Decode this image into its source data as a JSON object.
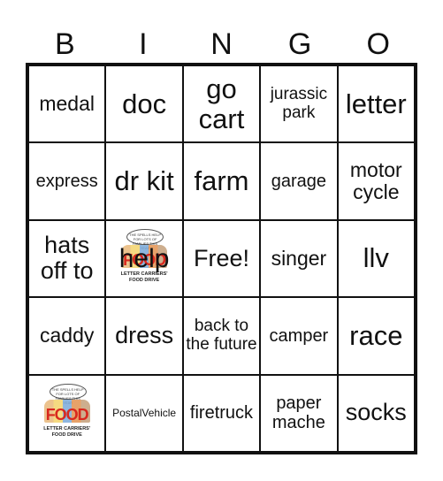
{
  "header": [
    "B",
    "I",
    "N",
    "G",
    "O"
  ],
  "cells": [
    {
      "text": "medal",
      "size": "s24"
    },
    {
      "text": "doc",
      "size": "s32"
    },
    {
      "text": "go cart",
      "size": "s32"
    },
    {
      "text": "jurassic park",
      "size": "s18"
    },
    {
      "text": "letter",
      "size": "s32"
    },
    {
      "text": "express",
      "size": "s20"
    },
    {
      "text": "dr kit",
      "size": "s32"
    },
    {
      "text": "farm",
      "size": "s32"
    },
    {
      "text": "garage",
      "size": "s20"
    },
    {
      "text": "motor cycle",
      "size": "s24"
    },
    {
      "text": "hats off to",
      "size": "s28"
    },
    {
      "text": "help",
      "size": "s32",
      "image": "food-drive-logo"
    },
    {
      "text": "Free!",
      "size": "s28"
    },
    {
      "text": "singer",
      "size": "s24"
    },
    {
      "text": "llv",
      "size": "s32"
    },
    {
      "text": "caddy",
      "size": "s24"
    },
    {
      "text": "dress",
      "size": "s28"
    },
    {
      "text": "back to the future",
      "size": "s18"
    },
    {
      "text": "camper",
      "size": "s20"
    },
    {
      "text": "race",
      "size": "s32"
    },
    {
      "text": "",
      "size": "s20",
      "image": "food-drive-logo"
    },
    {
      "text": "PostalVehicle",
      "size": "s12"
    },
    {
      "text": "firetruck",
      "size": "s20"
    },
    {
      "text": "paper mache",
      "size": "s20"
    },
    {
      "text": "socks",
      "size": "s28"
    }
  ],
  "logo": {
    "bubble_text": "THE SPELLS HELP FOR LOTS OF FAMILIES THIS YEAR",
    "word": "FOOD",
    "caption_line1": "LETTER CARRIERS'",
    "caption_line2": "FOOD DRIVE"
  }
}
